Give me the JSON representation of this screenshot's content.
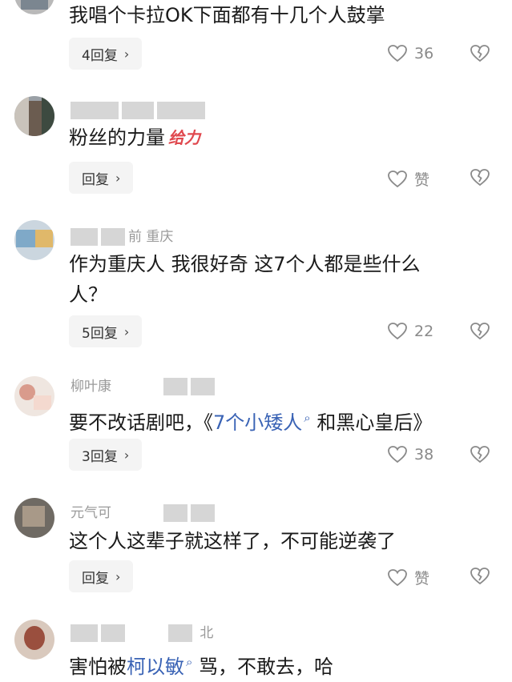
{
  "comments": [
    {
      "text": "我唱个卡拉OK下面都有十几个人鼓掌",
      "reply_label": "4回复",
      "like_label": "36"
    },
    {
      "text": "粉丝的力量",
      "sticker": "给力",
      "reply_label": "回复",
      "like_label": "赞"
    },
    {
      "meta_tail": "前  重庆",
      "text_line1": "作为重庆人 我很好奇 这7个人都是些什么",
      "text_line2": "人？",
      "reply_label": "5回复",
      "like_label": "22"
    },
    {
      "meta_head": "柳叶康",
      "text_pre": "要不改话剧吧，《",
      "text_link": "7个小矮人",
      "text_post": " 和黑心皇后》",
      "reply_label": "3回复",
      "like_label": "38"
    },
    {
      "meta_head": "元气可",
      "text": "这个人这辈子就这样了，不可能逆袭了",
      "reply_label": "回复",
      "like_label": "赞"
    },
    {
      "meta_tail": "北",
      "text_pre": "害怕被",
      "text_link": "柯以敏",
      "text_post": " 骂，不敢去，哈"
    }
  ],
  "icons": {
    "chevron": "chevron-right-icon",
    "like": "heart-outline-icon",
    "dislike": "broken-heart-icon",
    "search_mark": "search-mark-icon"
  },
  "colors": {
    "link": "#3a63b5",
    "reply_bg": "#f4f4f4",
    "meta": "#9a9a9a"
  }
}
